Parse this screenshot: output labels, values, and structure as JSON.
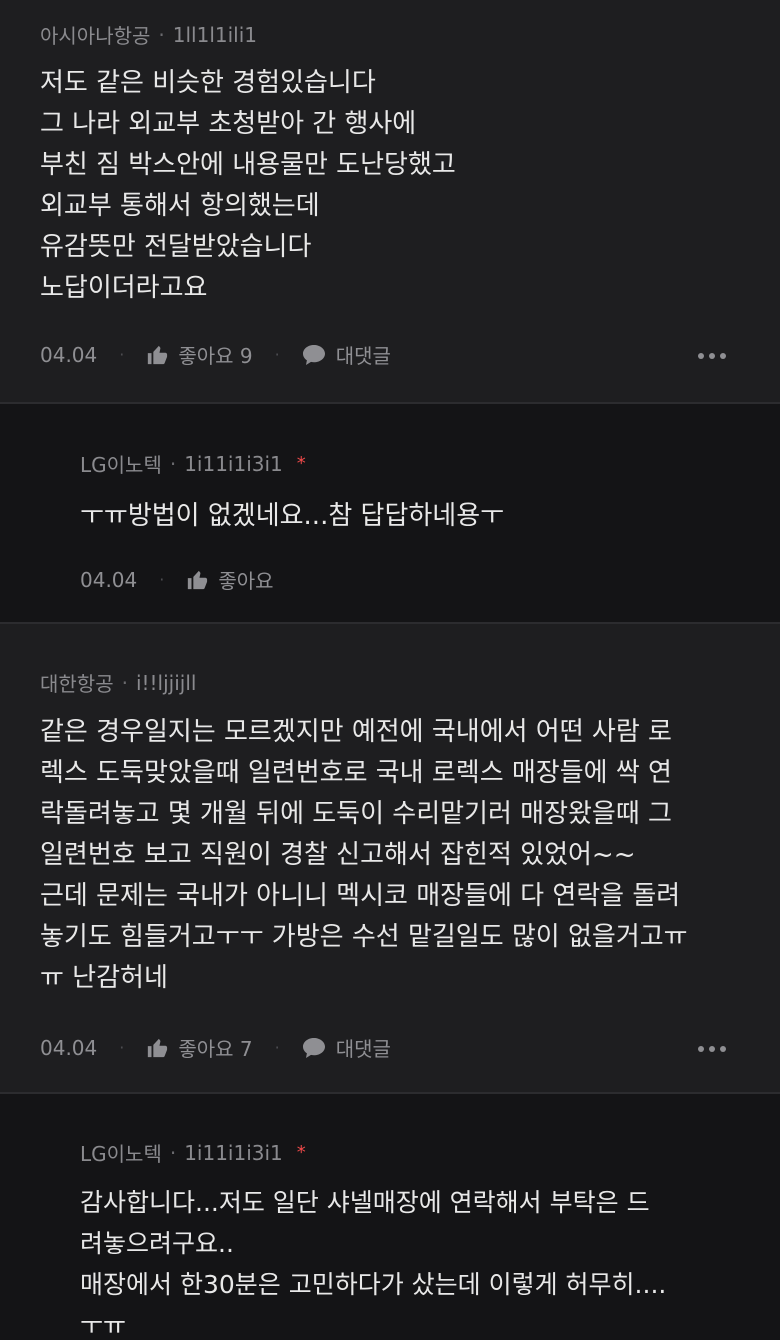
{
  "comments": [
    {
      "author": "아시아나항공",
      "handle": "1ll1l1ili1",
      "body": "저도 같은 비슷한 경험있습니다\n그 나라 외교부 초청받아 간 행사에\n부친 짐 박스안에 내용물만 도난당했고\n외교부 통해서 항의했는데\n유감뜻만 전달받았습니다\n노답이더라고요",
      "date": "04.04",
      "like_label": "좋아요 9",
      "reply_label": "대댓글"
    },
    {
      "author": "LG이노텍",
      "handle": "1i11i1i3i1",
      "author_mark": "*",
      "body": "ㅜㅠ방법이 없겠네요...참 답답하네용ㅜ",
      "date": "04.04",
      "like_label": "좋아요"
    },
    {
      "author": "대한항공",
      "handle": "i!!ljjijll",
      "body": "같은 경우일지는 모르겠지만 예전에 국내에서 어떤 사람 로\n렉스 도둑맞았을때 일련번호로 국내 로렉스 매장들에 싹 연\n락돌려놓고 몇 개월 뒤에 도둑이 수리맡기러 매장왔을때 그\n일련번호 보고 직원이 경찰 신고해서 잡힌적 있었어~~\n근데 문제는 국내가 아니니 멕시코 매장들에 다 연락을 돌려\n놓기도 힘들거고ㅜㅜ 가방은 수선 맡길일도 많이 없을거고ㅠ\nㅠ 난감허네",
      "date": "04.04",
      "like_label": "좋아요 7",
      "reply_label": "대댓글"
    },
    {
      "author": "LG이노텍",
      "handle": "1i11i1i3i1",
      "author_mark": "*",
      "body": "감사합니다...저도 일단 샤넬매장에 연락해서 부탁은 드\n려놓으려구요..\n매장에서 한30분은 고민하다가 샀는데 이렇게 허무히....\nㅜㅠ"
    }
  ],
  "separator": "·"
}
